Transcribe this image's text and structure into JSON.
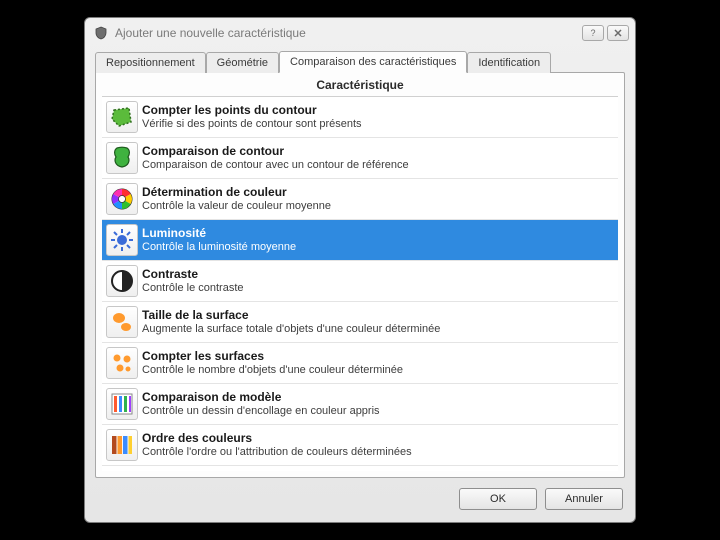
{
  "window": {
    "title": "Ajouter une nouvelle caractéristique"
  },
  "tabs": [
    {
      "label": "Repositionnement",
      "active": false
    },
    {
      "label": "Géométrie",
      "active": false
    },
    {
      "label": "Comparaison des caractéristiques",
      "active": true
    },
    {
      "label": "Identification",
      "active": false
    }
  ],
  "panel": {
    "header": "Caractéristique"
  },
  "items": [
    {
      "icon": "contour-points",
      "title": "Compter les points du contour",
      "desc": "Vérifie si des points de contour sont présents",
      "selected": false
    },
    {
      "icon": "contour-compare",
      "title": "Comparaison de contour",
      "desc": "Comparaison de contour avec un contour de référence",
      "selected": false
    },
    {
      "icon": "color-wheel",
      "title": "Détermination de couleur",
      "desc": "Contrôle la valeur de couleur moyenne",
      "selected": false
    },
    {
      "icon": "brightness",
      "title": "Luminosité",
      "desc": "Contrôle la luminosité moyenne",
      "selected": true
    },
    {
      "icon": "contrast",
      "title": "Contraste",
      "desc": "Contrôle le contraste",
      "selected": false
    },
    {
      "icon": "blob-size",
      "title": "Taille de la surface",
      "desc": "Augmente la surface totale d'objets d'une couleur déterminée",
      "selected": false
    },
    {
      "icon": "blob-count",
      "title": "Compter les surfaces",
      "desc": "Contrôle le nombre d'objets d'une couleur déterminée",
      "selected": false
    },
    {
      "icon": "pattern",
      "title": "Comparaison de modèle",
      "desc": "Contrôle un dessin d'encollage en couleur appris",
      "selected": false
    },
    {
      "icon": "color-order",
      "title": "Ordre des couleurs",
      "desc": "Contrôle l'ordre ou l'attribution de couleurs déterminées",
      "selected": false
    }
  ],
  "buttons": {
    "ok": "OK",
    "cancel": "Annuler"
  }
}
